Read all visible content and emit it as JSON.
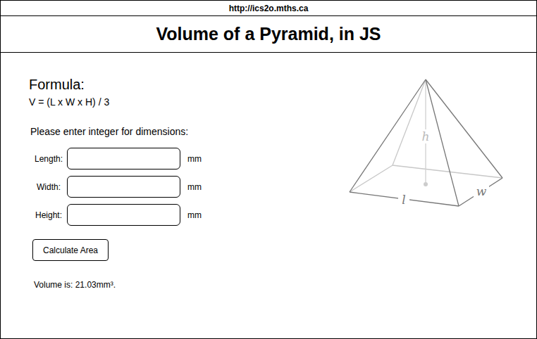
{
  "url": "http://ics2o.mths.ca",
  "title": "Volume of a Pyramid, in JS",
  "formula": {
    "heading": "Formula:",
    "text": "V = (L x W x H) / 3"
  },
  "prompt": "Please enter integer for dimensions:",
  "fields": [
    {
      "label": "Length:",
      "value": "",
      "unit": "mm"
    },
    {
      "label": "Width:",
      "value": "",
      "unit": "mm"
    },
    {
      "label": "Height:",
      "value": "",
      "unit": "mm"
    }
  ],
  "button": "Calculate Area",
  "result": "Volume is: 21.03mm³.",
  "diagram": {
    "height_label": "h",
    "length_label": "l",
    "width_label": "w"
  }
}
